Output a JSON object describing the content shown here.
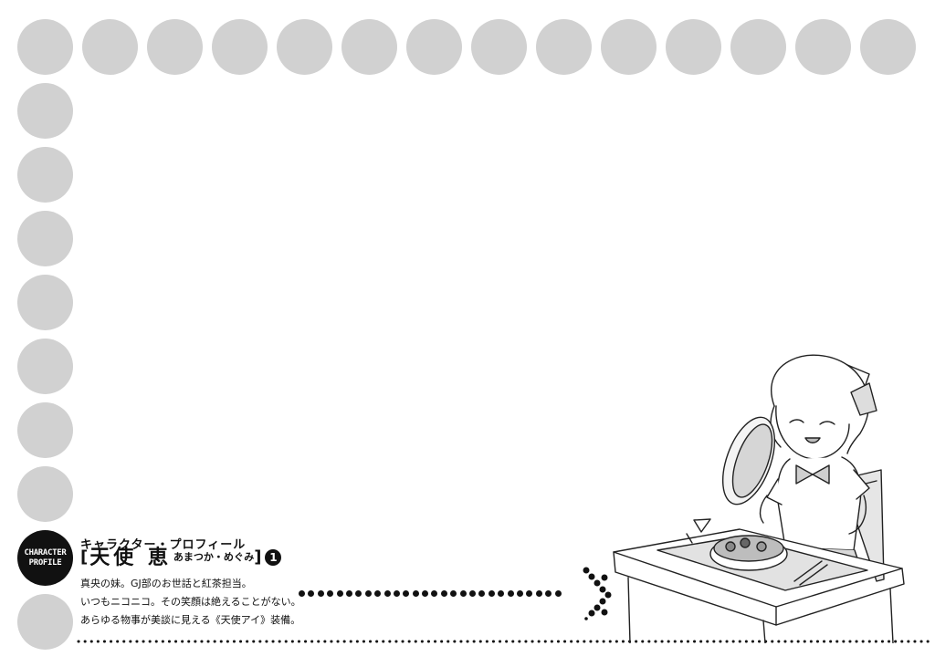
{
  "badge": {
    "line1": "CHARACTER",
    "line2": "PROFILE"
  },
  "profile": {
    "heading": "キャラクター・プロフィール",
    "bracket_open": "[",
    "name": "天使 恵",
    "reading": "あまつか・めぐみ",
    "bracket_close": "]",
    "number": "1"
  },
  "description": [
    "真央の妹。GJ部のお世話と紅茶担当。",
    "いつもニコニコ。その笑顔は絶えることがない。",
    "あらゆる物事が美談に見える《天使アイ》装備。"
  ],
  "colors": {
    "dot_gray": "#d1d1d1",
    "ink": "#111111"
  },
  "illustration": {
    "subject": "girl-holding-lunchbox-lid-at-desk"
  }
}
